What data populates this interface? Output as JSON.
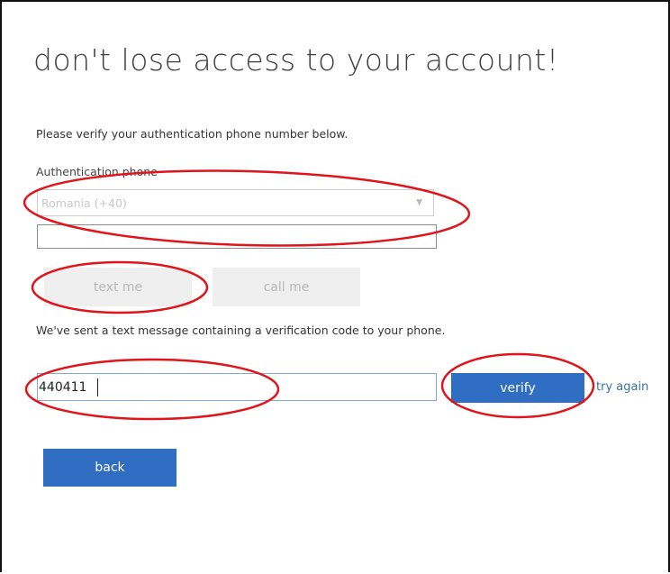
{
  "page": {
    "title": "don't lose access to your account!",
    "intro": "Please verify your authentication phone number below.",
    "phone_label": "Authentication phone",
    "country_select": {
      "value": "Romania (+40)"
    },
    "phone_number": {
      "value": ""
    },
    "text_me_label": "text me",
    "call_me_label": "call me",
    "sent_message": "We've sent a text message containing a verification code to your phone.",
    "code_input": {
      "value": "440411"
    },
    "verify_label": "verify",
    "try_again_label": "try again",
    "back_label": "back"
  },
  "colors": {
    "primary_button": "#2f6ec2",
    "annotation_red": "#e0141b",
    "link": "#3a6fb0"
  }
}
